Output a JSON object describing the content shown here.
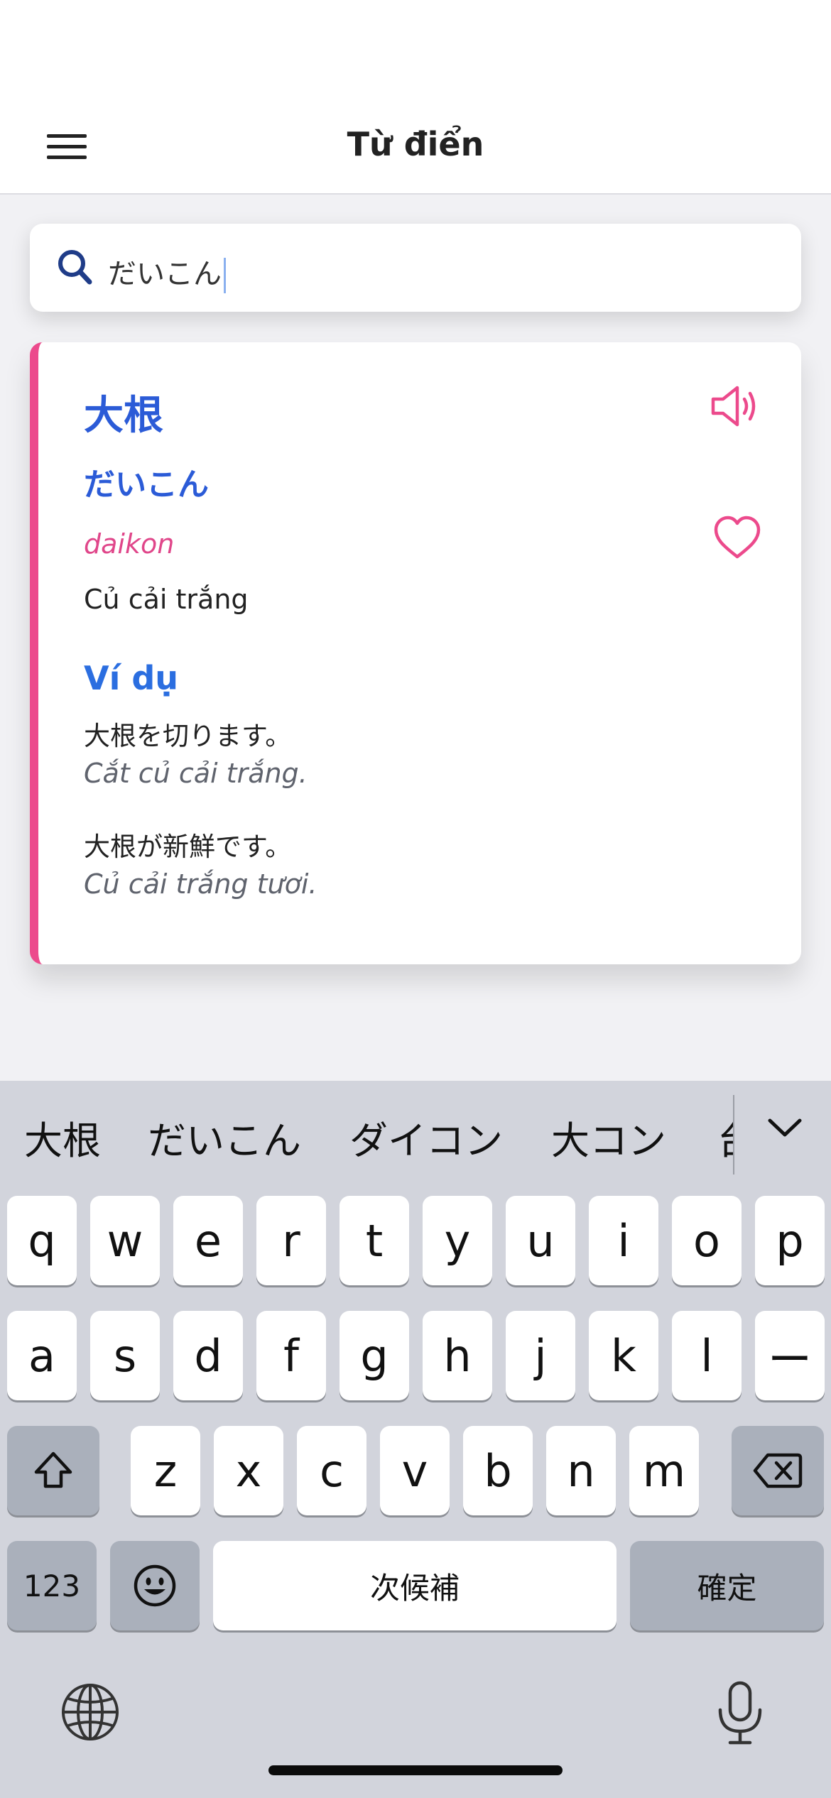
{
  "header": {
    "title": "Từ điển",
    "menu_icon": "hamburger-menu-icon"
  },
  "search": {
    "icon": "search-icon",
    "value": "だいこん"
  },
  "entry": {
    "kanji": "大根",
    "kana": "だいこん",
    "romaji": "daikon",
    "meaning": "Củ cải trắng",
    "speaker_icon": "speaker-icon",
    "favorite_icon": "heart-icon",
    "examples_heading": "Ví dụ",
    "examples": [
      {
        "jp": "大根を切ります。",
        "vi": "Cắt củ cải trắng."
      },
      {
        "jp": "大根が新鮮です。",
        "vi": "Củ cải trắng tươi."
      }
    ],
    "accent_color": "#ec4a8c",
    "primary_color": "#2b5bd7"
  },
  "keyboard": {
    "candidates": [
      "大根",
      "だいこん",
      "ダイコン",
      "大コン",
      "台"
    ],
    "rows": [
      [
        "q",
        "w",
        "e",
        "r",
        "t",
        "y",
        "u",
        "i",
        "o",
        "p"
      ],
      [
        "a",
        "s",
        "d",
        "f",
        "g",
        "h",
        "j",
        "k",
        "l",
        "ー"
      ],
      [
        "z",
        "x",
        "c",
        "v",
        "b",
        "n",
        "m"
      ]
    ],
    "numbers_label": "123",
    "space_label": "次候補",
    "confirm_label": "確定",
    "icons": {
      "shift": "shift-icon",
      "delete": "backspace-icon",
      "emoji": "emoji-icon",
      "globe": "globe-icon",
      "mic": "microphone-icon",
      "expand": "chevron-down-icon"
    }
  }
}
